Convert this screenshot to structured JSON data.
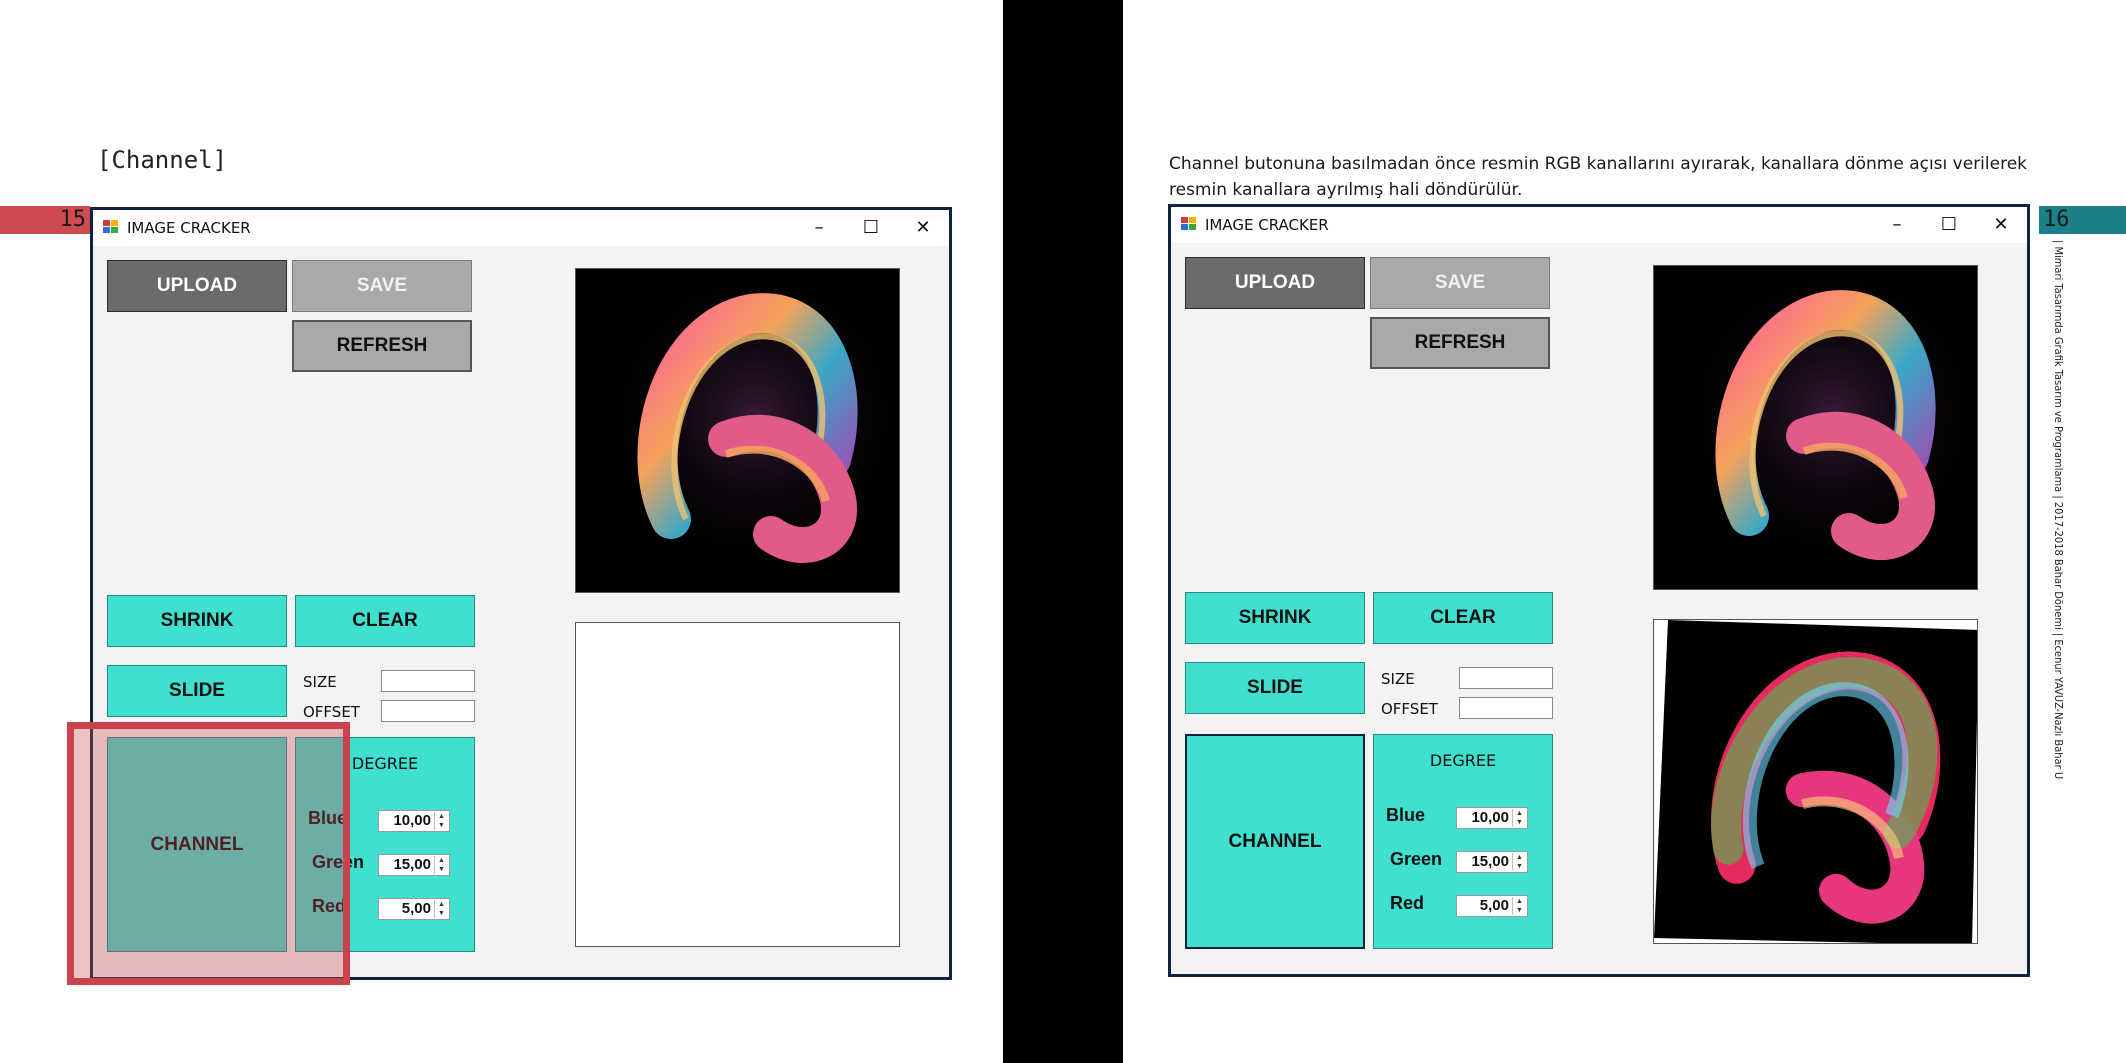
{
  "left_page": {
    "section_label": "[Channel]",
    "page_number": "15"
  },
  "right_page": {
    "description": "Channel butonuna basılmadan önce resmin RGB kanallarını ayırarak, kanallara dönme açısı verilerek resmin kanallara ayrılmış hali döndürülür.",
    "page_number": "16",
    "vertical_note": "| Mimari Tasarımda Grafik Tasarım ve Programlama | 2017-2018 Bahar Dönemi | Ecenur YAVUZ-Nazlı Bahar UĞRSAVAŞ"
  },
  "window": {
    "title": "IMAGE CRACKER",
    "minimize": "–",
    "maximize": "☐",
    "close": "✕",
    "buttons": {
      "upload": "UPLOAD",
      "save": "SAVE",
      "refresh": "REFRESH",
      "shrink": "SHRINK",
      "clear": "CLEAR",
      "slide": "SLIDE",
      "channel": "CHANNEL"
    },
    "fields": {
      "size_label": "SIZE",
      "size_value": "",
      "offset_label": "OFFSET",
      "offset_value": ""
    },
    "degree": {
      "title": "DEGREE",
      "blue_label": "Blue",
      "blue_value": "10,00",
      "green_label": "Green",
      "green_value": "15,00",
      "red_label": "Red",
      "red_value": "5,00"
    }
  },
  "colors": {
    "accent_turquoise": "#40e0d0",
    "highlight_red": "#c9424c",
    "page15_tab": "#cf4a51",
    "page16_tab": "#1c7f8a"
  }
}
